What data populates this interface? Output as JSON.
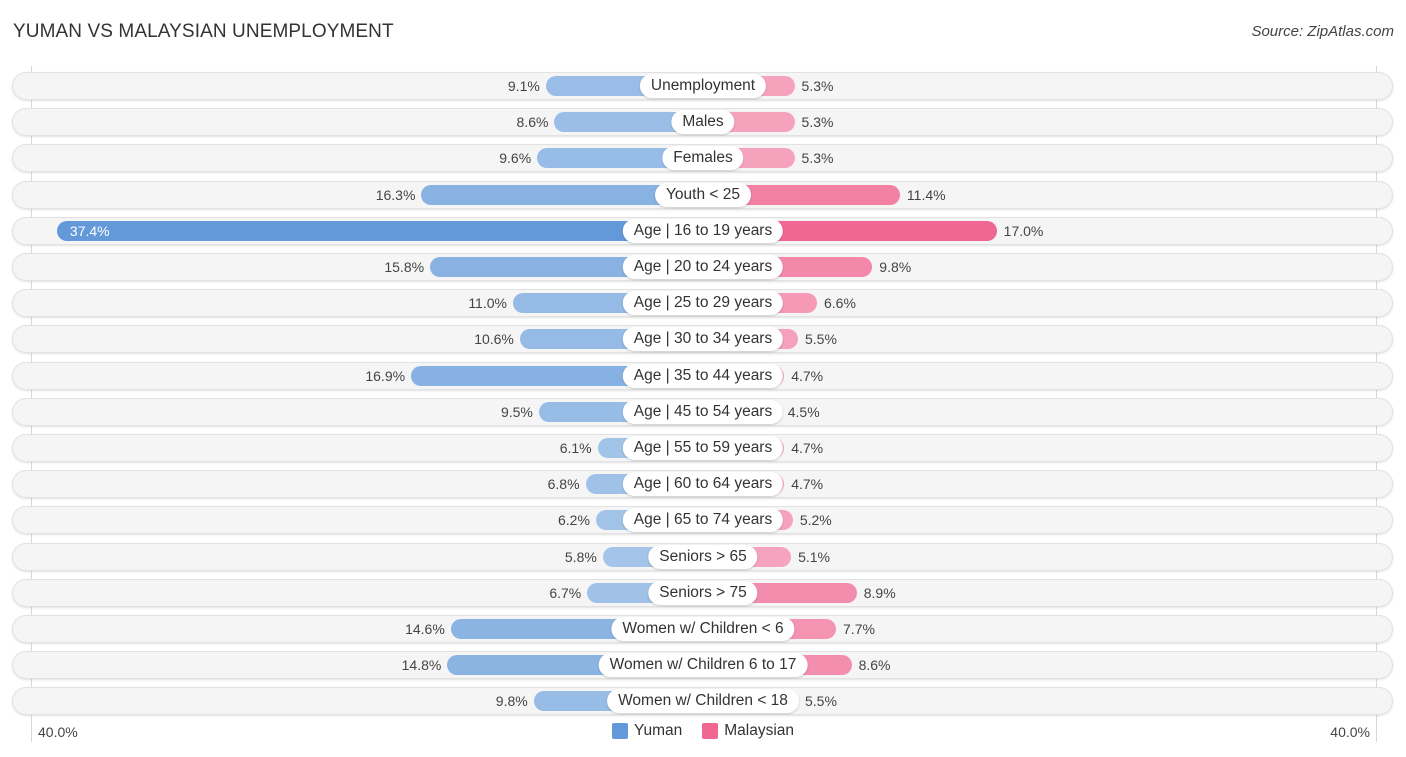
{
  "header": {
    "title": "YUMAN VS MALAYSIAN UNEMPLOYMENT",
    "source": "Source: ZipAtlas.com"
  },
  "colors": {
    "yuman_light": "#a9c8ea",
    "yuman_strong": "#6399d9",
    "malaysian_light": "#f6a9c2",
    "malaysian_strong": "#f06892"
  },
  "chart_data": {
    "type": "bar",
    "orientation": "horizontal-diverging",
    "title": "YUMAN VS MALAYSIAN UNEMPLOYMENT",
    "xlim": [
      -40,
      40
    ],
    "axis_labels": {
      "left": "40.0%",
      "right": "40.0%"
    },
    "legend": {
      "position": "bottom-center",
      "entries": [
        "Yuman",
        "Malaysian"
      ]
    },
    "categories": [
      "Unemployment",
      "Males",
      "Females",
      "Youth < 25",
      "Age | 16 to 19 years",
      "Age | 20 to 24 years",
      "Age | 25 to 29 years",
      "Age | 30 to 34 years",
      "Age | 35 to 44 years",
      "Age | 45 to 54 years",
      "Age | 55 to 59 years",
      "Age | 60 to 64 years",
      "Age | 65 to 74 years",
      "Seniors > 65",
      "Seniors > 75",
      "Women w/ Children < 6",
      "Women w/ Children 6 to 17",
      "Women w/ Children < 18"
    ],
    "series": [
      {
        "name": "Yuman",
        "side": "left",
        "values": [
          9.1,
          8.6,
          9.6,
          16.3,
          37.4,
          15.8,
          11.0,
          10.6,
          16.9,
          9.5,
          6.1,
          6.8,
          6.2,
          5.8,
          6.7,
          14.6,
          14.8,
          9.8
        ],
        "labels": [
          "9.1%",
          "8.6%",
          "9.6%",
          "16.3%",
          "37.4%",
          "15.8%",
          "11.0%",
          "10.6%",
          "16.9%",
          "9.5%",
          "6.1%",
          "6.8%",
          "6.2%",
          "5.8%",
          "6.7%",
          "14.6%",
          "14.8%",
          "9.8%"
        ]
      },
      {
        "name": "Malaysian",
        "side": "right",
        "values": [
          5.3,
          5.3,
          5.3,
          11.4,
          17.0,
          9.8,
          6.6,
          5.5,
          4.7,
          4.5,
          4.7,
          4.7,
          5.2,
          5.1,
          8.9,
          7.7,
          8.6,
          5.5
        ],
        "labels": [
          "5.3%",
          "5.3%",
          "5.3%",
          "11.4%",
          "17.0%",
          "9.8%",
          "6.6%",
          "5.5%",
          "4.7%",
          "4.5%",
          "4.7%",
          "4.7%",
          "5.2%",
          "5.1%",
          "8.9%",
          "7.7%",
          "8.6%",
          "5.5%"
        ]
      }
    ]
  }
}
